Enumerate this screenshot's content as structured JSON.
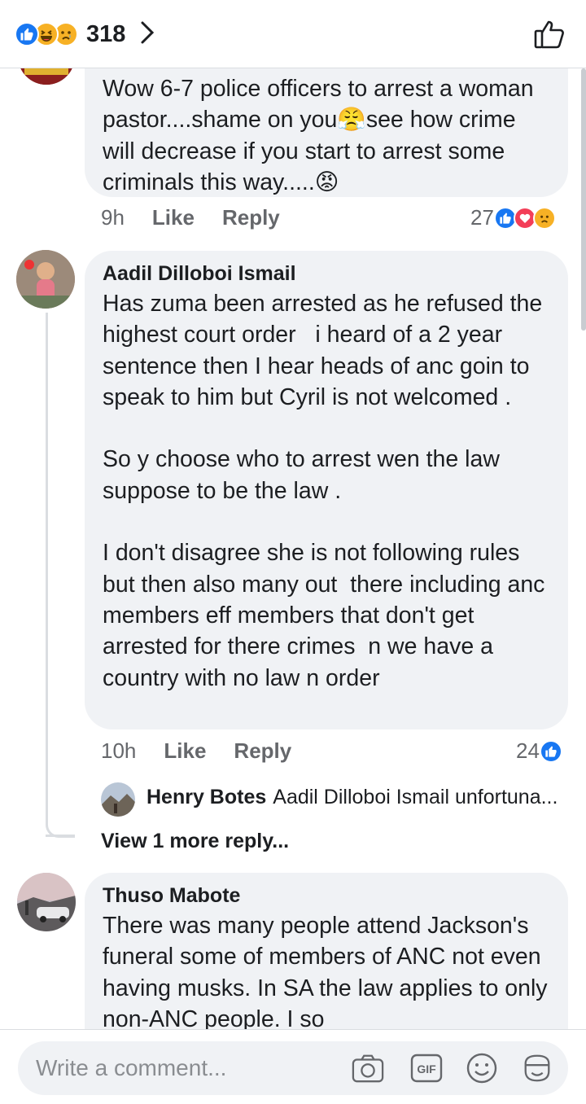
{
  "header": {
    "reaction_count": "318",
    "reaction_icons": [
      "like-icon",
      "haha-icon",
      "sad-icon"
    ]
  },
  "comments": [
    {
      "text": "Wow 6-7 police officers to arrest a woman pastor....shame on you😤see how crime will decrease if you start to arrest some criminals this way.....😡",
      "time": "9h",
      "like_label": "Like",
      "reply_label": "Reply",
      "reaction_count": "27",
      "reaction_icons": [
        "like-icon",
        "love-icon",
        "sad-icon"
      ]
    },
    {
      "author": "Aadil Dilloboi Ismail",
      "text": "Has zuma been arrested as he refused the highest court order   i heard of a 2 year sentence then I hear heads of anc goin to speak to him but Cyril is not welcomed .\n\nSo y choose who to arrest wen the law suppose to be the law .\n\nI don't disagree she is not following rules but then also many out  there including anc members eff members that don't get arrested for there crimes  n we have a country with no law n order",
      "time": "10h",
      "like_label": "Like",
      "reply_label": "Reply",
      "reaction_count": "24",
      "reaction_icons": [
        "like-icon"
      ],
      "reply_preview": {
        "author": "Henry Botes",
        "text": "Aadil Dilloboi Ismail unfortuna..."
      },
      "view_more": "View 1 more reply..."
    },
    {
      "author": "Thuso Mabote",
      "text": "There was many people attend Jackson's funeral some of members of ANC not even having musks. In SA the law applies to only non-ANC people. I so"
    }
  ],
  "composer": {
    "placeholder": "Write a comment...",
    "icons": [
      "camera-icon",
      "gif-icon",
      "emoji-icon",
      "sticker-icon"
    ]
  },
  "colors": {
    "like_blue": "#1877f2",
    "love_red": "#f33e58",
    "reaction_yellow": "#f7b125",
    "bubble_bg": "#f0f2f5",
    "meta_gray": "#65676b"
  }
}
